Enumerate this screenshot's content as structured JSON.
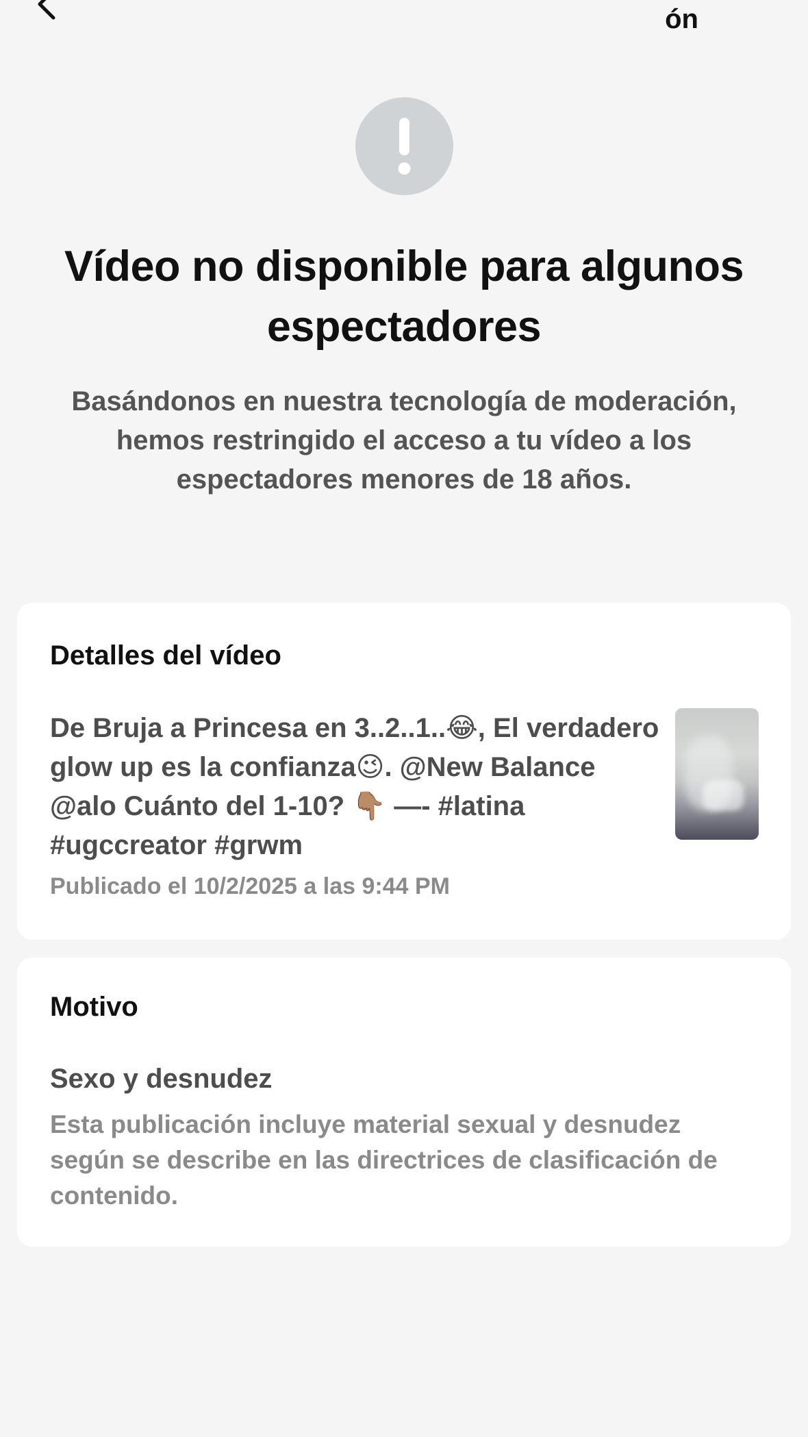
{
  "header": {
    "back_icon": "chevron-left-icon",
    "title_fragment": "ón"
  },
  "alert": {
    "icon": "exclamation-icon",
    "color": "#d0d3d5"
  },
  "headline": "Vídeo no disponible para algunos espectadores",
  "subtext": "Basándonos en nuestra tecnología de moderación, hemos restringido el acceso a tu vídeo a los espectadores menores de 18 años.",
  "details_card": {
    "title": "Detalles del vídeo",
    "caption": "De Bruja a Princesa en 3..2..1..😂, El verdadero glow up es la confianza😉. @New Balance @alo  Cuánto del 1-10? 👇🏽 —- #latina #ugccreator #grwm",
    "published": "Publicado el 10/2/2025 a las 9:44 PM"
  },
  "reason_card": {
    "title": "Motivo",
    "reason": "Sexo y desnudez",
    "description": "Esta publicación incluye material sexual y desnudez según se describe en las directrices de clasificación de contenido."
  }
}
